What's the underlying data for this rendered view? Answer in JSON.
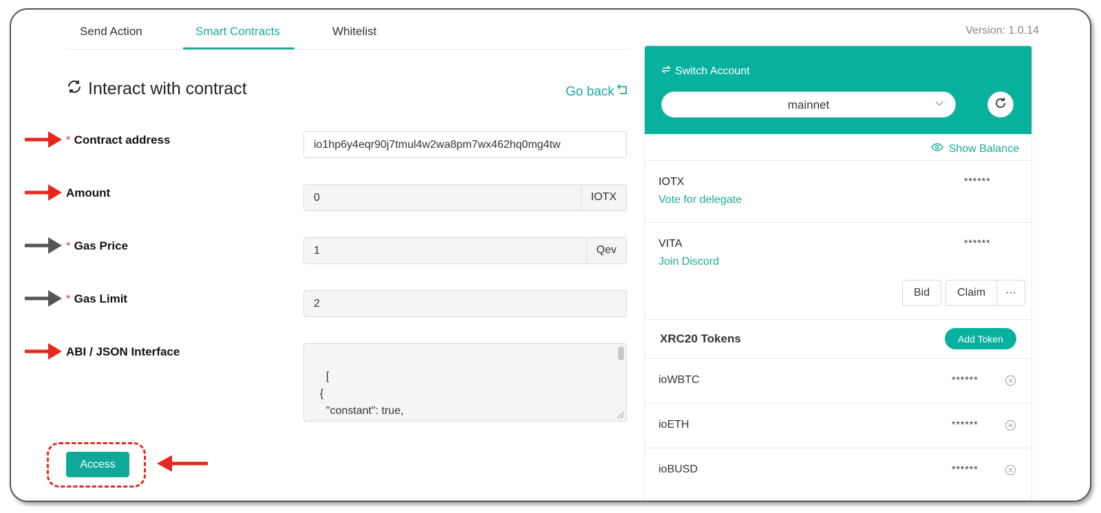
{
  "tabs": [
    {
      "label": "Send Action"
    },
    {
      "label": "Smart Contracts"
    },
    {
      "label": "Whitelist"
    }
  ],
  "version": "Version: 1.0.14",
  "section_title": "Interact with contract",
  "go_back": "Go back",
  "form": {
    "contract_address": {
      "label": "Contract address",
      "required": "*",
      "value": "io1hp6y4eqr90j7tmul4w2wa8pm7wx462hq0mg4tw"
    },
    "amount": {
      "label": "Amount",
      "value": "0",
      "unit": "IOTX"
    },
    "gas_price": {
      "label": "Gas Price",
      "required": "*",
      "value": "1",
      "unit": "Qev"
    },
    "gas_limit": {
      "label": "Gas Limit",
      "required": "*",
      "value": "2"
    },
    "abi": {
      "label": "ABI / JSON Interface",
      "value": "[\n  {\n    \"constant\": true,\n    \"inputs\": [],"
    }
  },
  "access_button": "Access",
  "account": {
    "switch_label": "Switch Account",
    "network": "mainnet",
    "show_balance": "Show Balance",
    "coins": [
      {
        "name": "IOTX",
        "balance": "******",
        "link": "Vote for delegate"
      },
      {
        "name": "VITA",
        "balance": "******",
        "link": "Join Discord"
      }
    ],
    "vita_buttons": {
      "bid": "Bid",
      "claim": "Claim",
      "more": "···"
    },
    "xrc20_title": "XRC20 Tokens",
    "add_token": "Add Token",
    "tokens": [
      {
        "name": "ioWBTC",
        "balance": "******"
      },
      {
        "name": "ioETH",
        "balance": "******"
      },
      {
        "name": "ioBUSD",
        "balance": "******"
      }
    ]
  },
  "colors": {
    "accent": "#07b19e",
    "annotation_red": "#e8261b",
    "annotation_gray": "#555555"
  }
}
